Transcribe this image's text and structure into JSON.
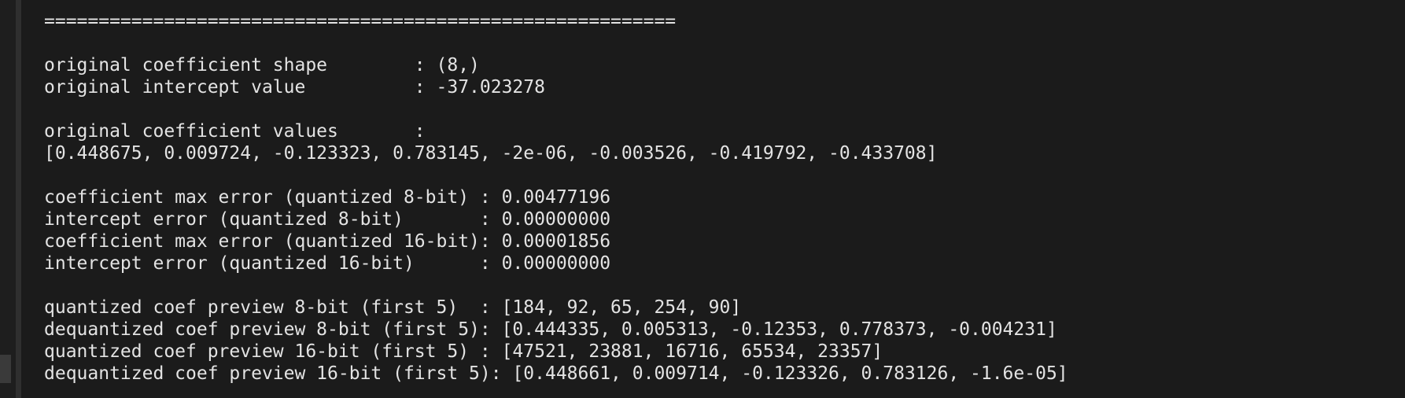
{
  "terminal": {
    "lines": [
      "==========================================================",
      "",
      "original coefficient shape        : (8,)",
      "original intercept value          : -37.023278",
      "",
      "original coefficient values       :",
      "[0.448675, 0.009724, -0.123323, 0.783145, -2e-06, -0.003526, -0.419792, -0.433708]",
      "",
      "coefficient max error (quantized 8-bit) : 0.00477196",
      "intercept error (quantized 8-bit)       : 0.00000000",
      "coefficient max error (quantized 16-bit): 0.00001856",
      "intercept error (quantized 16-bit)      : 0.00000000",
      "",
      "quantized coef preview 8-bit (first 5)  : [184, 92, 65, 254, 90]",
      "dequantized coef preview 8-bit (first 5): [0.444335, 0.005313, -0.12353, 0.778373, -0.004231]",
      "quantized coef preview 16-bit (first 5) : [47521, 23881, 16716, 65534, 23357]",
      "dequantized coef preview 16-bit (first 5): [0.448661, 0.009714, -0.123326, 0.783126, -1.6e-05]"
    ]
  }
}
